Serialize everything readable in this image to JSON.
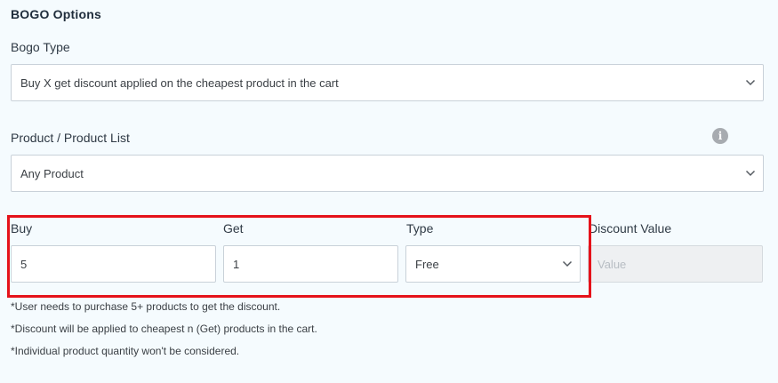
{
  "section": {
    "title": "BOGO Options"
  },
  "bogo_type": {
    "label": "Bogo Type",
    "selected": "Buy X get discount applied on the cheapest product in the cart"
  },
  "product_list": {
    "label": "Product / Product List",
    "selected": "Any Product",
    "info_icon_glyph": "i"
  },
  "fields": {
    "buy": {
      "label": "Buy",
      "value": "5"
    },
    "get": {
      "label": "Get",
      "value": "1"
    },
    "type": {
      "label": "Type",
      "selected": "Free"
    },
    "discount_value": {
      "label": "Discount Value",
      "placeholder": "Value"
    }
  },
  "notes": [
    "*User needs to purchase 5+ products to get the discount.",
    "*Discount will be applied to cheapest n (Get) products in the cart.",
    "*Individual product quantity won't be considered."
  ],
  "colors": {
    "background": "#f5fbfe",
    "highlight_border": "#e5121a",
    "info_icon": "#a7abb0",
    "disabled_field": "#eef0f2"
  }
}
